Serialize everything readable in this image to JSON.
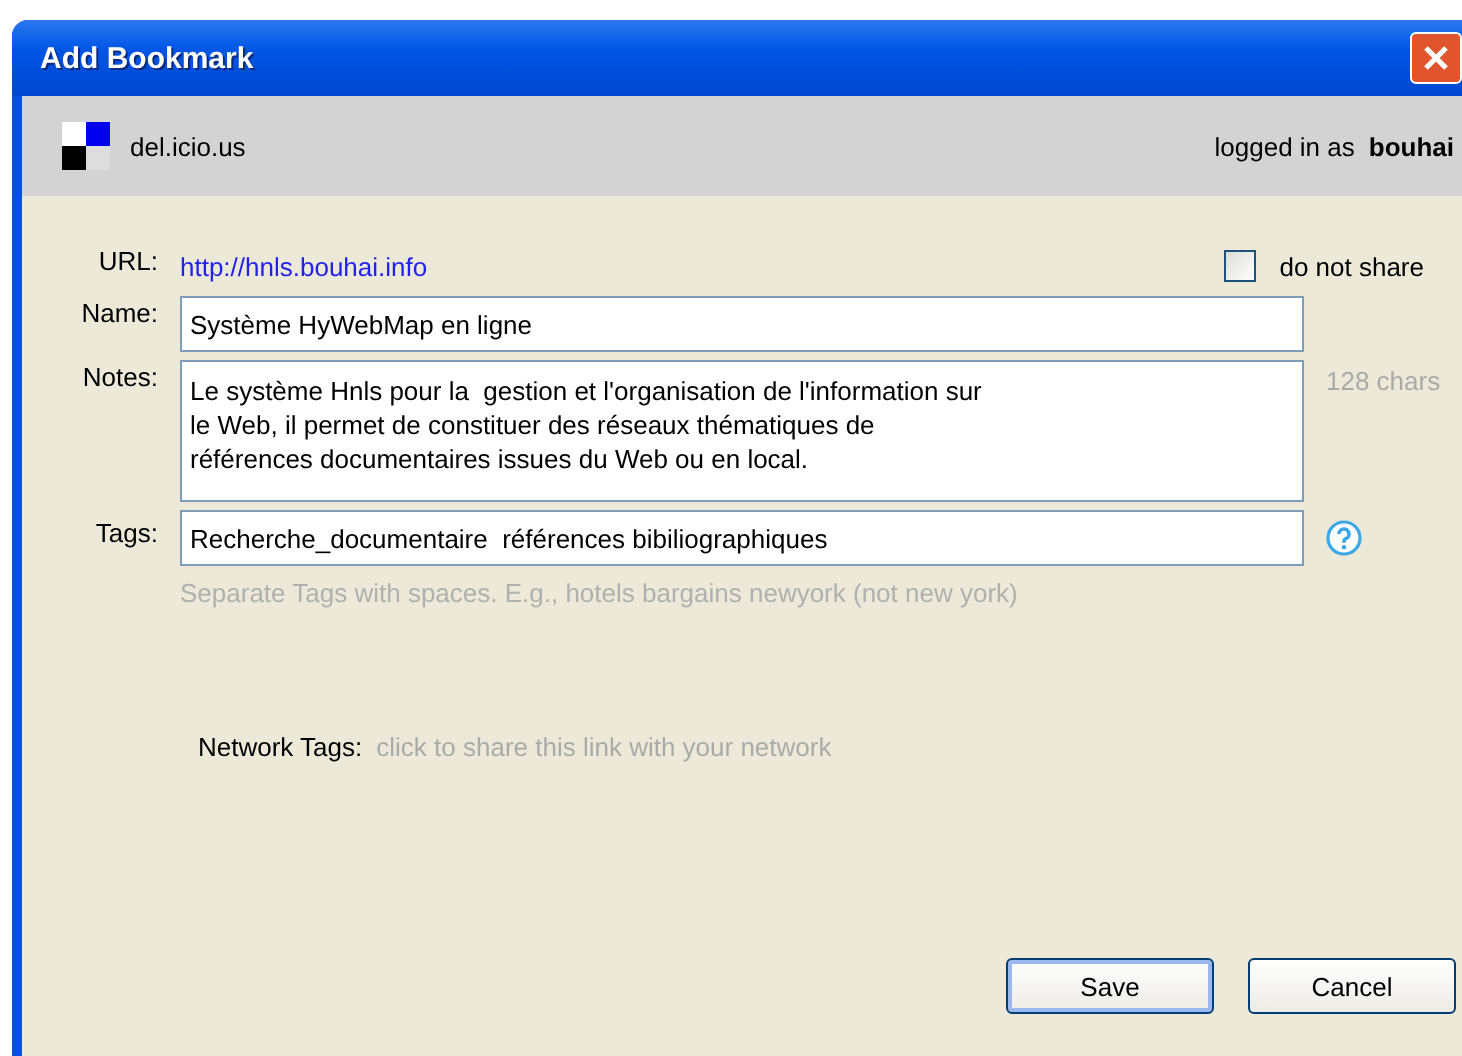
{
  "window": {
    "title": "Add Bookmark"
  },
  "header": {
    "service": "del.icio.us",
    "login_label": "logged in as",
    "user": "bouhai"
  },
  "url": {
    "label": "URL:",
    "value": "http://hnls.bouhai.info"
  },
  "do_not_share": {
    "label": "do not share",
    "checked": false
  },
  "name": {
    "label": "Name:",
    "value": "Système HyWebMap en ligne"
  },
  "notes": {
    "label": "Notes:",
    "value": "Le système Hnls pour la  gestion et l'organisation de l'information sur\nle Web, il permet de constituer des réseaux thématiques de\nréférences documentaires issues du Web ou en local.",
    "counter": "128 chars"
  },
  "tags": {
    "label": "Tags:",
    "value": "Recherche_documentaire  références bibiliographiques",
    "hint": "Separate Tags with spaces. E.g., hotels bargains newyork (not new york)"
  },
  "network_tags": {
    "label": "Network Tags:",
    "link": "click to share this link with your network"
  },
  "buttons": [
    "Save",
    "Cancel"
  ]
}
